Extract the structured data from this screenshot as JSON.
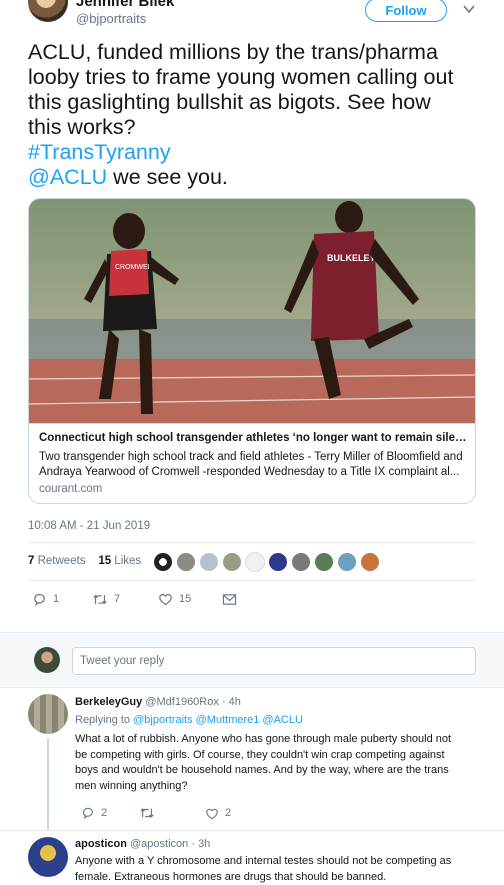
{
  "tweet": {
    "author_name": "Jennifer Bilek",
    "author_handle": "@bjportraits",
    "follow_label": "Follow",
    "text_lines": [
      "ACLU, funded millions by the trans/pharma",
      "looby tries to frame young women calling out",
      "this gaslighting bullshit as bigots. See how",
      "this works?"
    ],
    "hashtag": "#TransTyranny",
    "mention": "@ACLU",
    "mention_suffix": " we see you.",
    "timestamp": "10:08 AM - 21 Jun 2019",
    "retweets_count": "7",
    "retweets_label": "Retweets",
    "likes_count": "15",
    "likes_label": "Likes",
    "actions": {
      "replies": "1",
      "retweets": "7",
      "likes": "15"
    }
  },
  "card": {
    "title": "Connecticut high school transgender athletes ‘no longer want to remain silen...",
    "description_lines": [
      "Two transgender high school track and field athletes - Terry Miller of Bloomfield and",
      "Andraya Yearwood of Cromwell -responded Wednesday to a Title IX complaint al..."
    ],
    "domain": "courant.com",
    "image_labels": {
      "left_jersey": "CROMWELL",
      "right_jersey": "BULKELEY"
    }
  },
  "reply_box": {
    "placeholder": "Tweet your reply"
  },
  "replies": [
    {
      "name": "BerkeleyGuy",
      "handle": "@Mdf1960Rox",
      "time": "· 4h",
      "replying_label": "Replying to",
      "replying_to": "@bjportraits @Muttmere1 @ACLU",
      "text_lines": [
        "What a lot of rubbish. Anyone who has gone through male puberty should not",
        "be competing with girls. Of course, they couldn't win crap competing against",
        "boys and wouldn't be household names. And by the way, where are the trans",
        "men winning anything?"
      ],
      "replies_count": "2",
      "retweets_count": "",
      "likes_count": "2"
    },
    {
      "name": "aposticon",
      "handle": "@aposticon",
      "time": "· 3h",
      "text_lines": [
        "Anyone with a Y chromosome and internal testes should not be competing as",
        "female. Extraneous hormones are drugs that should be banned."
      ]
    }
  ],
  "colors": {
    "accent": "#1da1f2",
    "muted": "#657786",
    "text": "#14171a",
    "border": "#e6ecf0"
  },
  "icons": [
    "caret-down-icon",
    "reply-icon",
    "retweet-icon",
    "like-icon",
    "dm-icon"
  ]
}
